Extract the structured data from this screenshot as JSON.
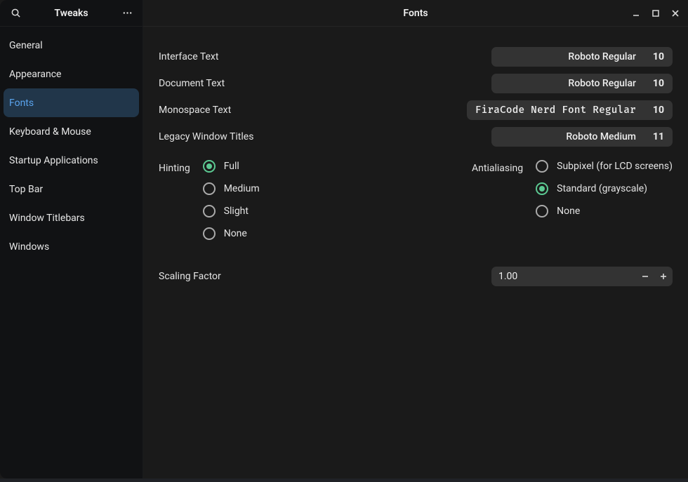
{
  "app_title": "Tweaks",
  "page_title": "Fonts",
  "sidebar": {
    "items": [
      {
        "label": "General"
      },
      {
        "label": "Appearance"
      },
      {
        "label": "Fonts",
        "selected": true
      },
      {
        "label": "Keyboard & Mouse"
      },
      {
        "label": "Startup Applications"
      },
      {
        "label": "Top Bar"
      },
      {
        "label": "Window Titlebars"
      },
      {
        "label": "Windows"
      }
    ]
  },
  "fonts": {
    "rows": [
      {
        "label": "Interface Text",
        "font": "Roboto Regular",
        "size": "10",
        "mono": false
      },
      {
        "label": "Document Text",
        "font": "Roboto Regular",
        "size": "10",
        "mono": false
      },
      {
        "label": "Monospace Text",
        "font": "FiraCode Nerd Font Regular",
        "size": "10",
        "mono": true
      },
      {
        "label": "Legacy Window Titles",
        "font": "Roboto Medium",
        "size": "11",
        "mono": false
      }
    ]
  },
  "hinting": {
    "label": "Hinting",
    "options": [
      {
        "label": "Full",
        "selected": true
      },
      {
        "label": "Medium",
        "selected": false
      },
      {
        "label": "Slight",
        "selected": false
      },
      {
        "label": "None",
        "selected": false
      }
    ]
  },
  "antialiasing": {
    "label": "Antialiasing",
    "options": [
      {
        "label": "Subpixel (for LCD screens)",
        "selected": false
      },
      {
        "label": "Standard (grayscale)",
        "selected": true
      },
      {
        "label": "None",
        "selected": false
      }
    ]
  },
  "scaling": {
    "label": "Scaling Factor",
    "value": "1.00"
  },
  "icons": {
    "search": "search-icon",
    "menu": "more-icon",
    "minimize": "window-minimize-icon",
    "maximize": "window-maximize-icon",
    "close": "window-close-icon",
    "minus": "minus-icon",
    "plus": "plus-icon"
  }
}
